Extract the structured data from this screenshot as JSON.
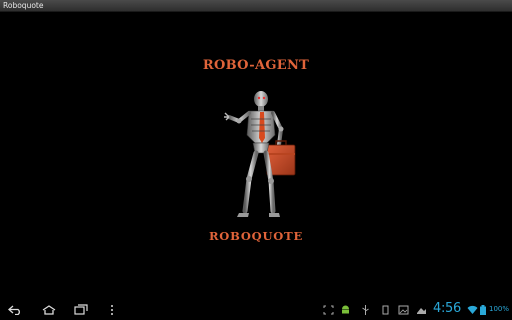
{
  "window": {
    "title": "Roboquote"
  },
  "splash": {
    "top_text": "ROBO-AGENT",
    "bottom_text": "ROBOQUOTE",
    "image": "robot-with-briefcase-illustration",
    "accent_color": "#e0643a"
  },
  "navbar": {
    "buttons": [
      "back-icon",
      "home-icon",
      "recent-apps-icon",
      "menu-icon"
    ]
  },
  "status": {
    "icons": [
      "screenshot-icon",
      "android-debug-icon",
      "usb-icon",
      "gallery-icon",
      "picture-icon",
      "download-icon"
    ],
    "time": "4:56",
    "battery": "100%",
    "accent_color": "#2aa8d8"
  }
}
